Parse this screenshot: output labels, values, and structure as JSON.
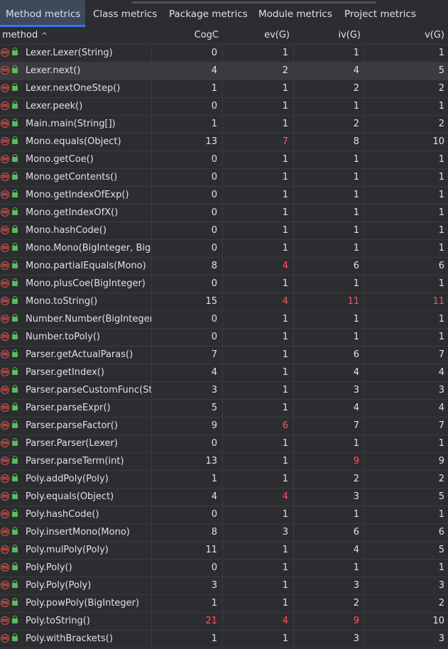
{
  "tabs": [
    {
      "label": "Method metrics",
      "active": true
    },
    {
      "label": "Class metrics",
      "active": false
    },
    {
      "label": "Package metrics",
      "active": false
    },
    {
      "label": "Module metrics",
      "active": false
    },
    {
      "label": "Project metrics",
      "active": false
    }
  ],
  "columns": [
    "method",
    "CogC",
    "ev(G)",
    "iv(G)",
    "v(G)"
  ],
  "sort_indicator": "^",
  "highlight_color": "#ff5261",
  "rows": [
    {
      "method": "Lexer.Lexer(String)",
      "cogc": "0",
      "evg": "1",
      "ivg": "1",
      "vg": "1"
    },
    {
      "method": "Lexer.next()",
      "cogc": "4",
      "evg": "2",
      "ivg": "4",
      "vg": "5",
      "selected": true
    },
    {
      "method": "Lexer.nextOneStep()",
      "cogc": "1",
      "evg": "1",
      "ivg": "2",
      "vg": "2"
    },
    {
      "method": "Lexer.peek()",
      "cogc": "0",
      "evg": "1",
      "ivg": "1",
      "vg": "1"
    },
    {
      "method": "Main.main(String[])",
      "cogc": "1",
      "evg": "1",
      "ivg": "2",
      "vg": "2"
    },
    {
      "method": "Mono.equals(Object)",
      "cogc": "13",
      "evg": "7",
      "ivg": "8",
      "vg": "10",
      "red": [
        "evg"
      ]
    },
    {
      "method": "Mono.getCoe()",
      "cogc": "0",
      "evg": "1",
      "ivg": "1",
      "vg": "1"
    },
    {
      "method": "Mono.getContents()",
      "cogc": "0",
      "evg": "1",
      "ivg": "1",
      "vg": "1"
    },
    {
      "method": "Mono.getIndexOfExp()",
      "cogc": "0",
      "evg": "1",
      "ivg": "1",
      "vg": "1"
    },
    {
      "method": "Mono.getIndexOfX()",
      "cogc": "0",
      "evg": "1",
      "ivg": "1",
      "vg": "1"
    },
    {
      "method": "Mono.hashCode()",
      "cogc": "0",
      "evg": "1",
      "ivg": "1",
      "vg": "1"
    },
    {
      "method": "Mono.Mono(BigInteger, BigI",
      "cogc": "0",
      "evg": "1",
      "ivg": "1",
      "vg": "1"
    },
    {
      "method": "Mono.partialEquals(Mono)",
      "cogc": "8",
      "evg": "4",
      "ivg": "6",
      "vg": "6",
      "red": [
        "evg"
      ]
    },
    {
      "method": "Mono.plusCoe(BigInteger)",
      "cogc": "0",
      "evg": "1",
      "ivg": "1",
      "vg": "1"
    },
    {
      "method": "Mono.toString()",
      "cogc": "15",
      "evg": "4",
      "ivg": "11",
      "vg": "11",
      "red": [
        "evg",
        "ivg",
        "vg"
      ]
    },
    {
      "method": "Number.Number(BigInteger)",
      "cogc": "0",
      "evg": "1",
      "ivg": "1",
      "vg": "1"
    },
    {
      "method": "Number.toPoly()",
      "cogc": "0",
      "evg": "1",
      "ivg": "1",
      "vg": "1"
    },
    {
      "method": "Parser.getActualParas()",
      "cogc": "7",
      "evg": "1",
      "ivg": "6",
      "vg": "7"
    },
    {
      "method": "Parser.getIndex()",
      "cogc": "4",
      "evg": "1",
      "ivg": "4",
      "vg": "4"
    },
    {
      "method": "Parser.parseCustomFunc(St",
      "cogc": "3",
      "evg": "1",
      "ivg": "3",
      "vg": "3"
    },
    {
      "method": "Parser.parseExpr()",
      "cogc": "5",
      "evg": "1",
      "ivg": "4",
      "vg": "4"
    },
    {
      "method": "Parser.parseFactor()",
      "cogc": "9",
      "evg": "6",
      "ivg": "7",
      "vg": "7",
      "red": [
        "evg"
      ]
    },
    {
      "method": "Parser.Parser(Lexer)",
      "cogc": "0",
      "evg": "1",
      "ivg": "1",
      "vg": "1"
    },
    {
      "method": "Parser.parseTerm(int)",
      "cogc": "13",
      "evg": "1",
      "ivg": "9",
      "vg": "9",
      "red": [
        "ivg"
      ]
    },
    {
      "method": "Poly.addPoly(Poly)",
      "cogc": "1",
      "evg": "1",
      "ivg": "2",
      "vg": "2"
    },
    {
      "method": "Poly.equals(Object)",
      "cogc": "4",
      "evg": "4",
      "ivg": "3",
      "vg": "5",
      "red": [
        "evg"
      ]
    },
    {
      "method": "Poly.hashCode()",
      "cogc": "0",
      "evg": "1",
      "ivg": "1",
      "vg": "1"
    },
    {
      "method": "Poly.insertMono(Mono)",
      "cogc": "8",
      "evg": "3",
      "ivg": "6",
      "vg": "6"
    },
    {
      "method": "Poly.mulPoly(Poly)",
      "cogc": "11",
      "evg": "1",
      "ivg": "4",
      "vg": "5"
    },
    {
      "method": "Poly.Poly()",
      "cogc": "0",
      "evg": "1",
      "ivg": "1",
      "vg": "1"
    },
    {
      "method": "Poly.Poly(Poly)",
      "cogc": "3",
      "evg": "1",
      "ivg": "3",
      "vg": "3"
    },
    {
      "method": "Poly.powPoly(BigInteger)",
      "cogc": "1",
      "evg": "1",
      "ivg": "2",
      "vg": "2"
    },
    {
      "method": "Poly.toString()",
      "cogc": "21",
      "evg": "4",
      "ivg": "9",
      "vg": "10",
      "red": [
        "cogc",
        "evg",
        "ivg"
      ]
    },
    {
      "method": "Poly.withBrackets()",
      "cogc": "1",
      "evg": "1",
      "ivg": "3",
      "vg": "3"
    }
  ]
}
